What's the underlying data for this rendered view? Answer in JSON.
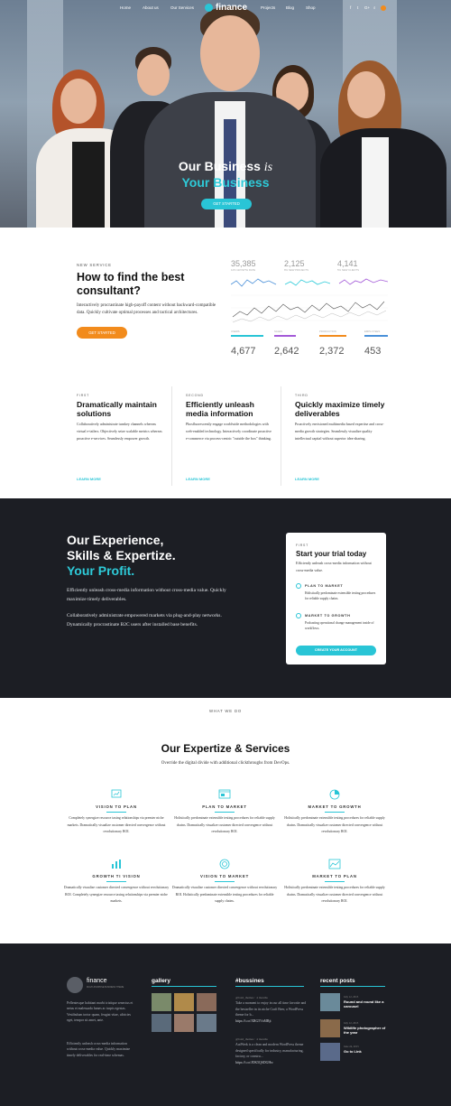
{
  "nav": {
    "left": [
      "Home",
      "About us",
      "Our Services"
    ],
    "right": [
      "Projects",
      "Blog",
      "Shop"
    ],
    "logo": "finance",
    "social": [
      "f",
      "t",
      "G+",
      "⌕"
    ]
  },
  "hero": {
    "title_a": "Our Business",
    "title_is": "is",
    "title_b": "Your Business",
    "button": "GET STARTED"
  },
  "consult": {
    "label": "NEW SERVICE",
    "title": "How to find the best consultant?",
    "text": "Interactively procrastinate high-payoff content without backward-compatible data. Quickly cultivate optimal processes and tactical architectures.",
    "button": "GET STARTED"
  },
  "stats_top": [
    {
      "value": "35,385",
      "label": "12% GROWTH RATE"
    },
    {
      "value": "2,125",
      "label": "8% NEW PROJECTS"
    },
    {
      "value": "4,141",
      "label": "5% NEW CLIENTS"
    }
  ],
  "stats_bottom": [
    {
      "value": "4,677",
      "label": "USERS"
    },
    {
      "value": "2,642",
      "label": "SALES"
    },
    {
      "value": "2,372",
      "label": "PRODUCTION"
    },
    {
      "value": "453",
      "label": "EMPLOYEES"
    }
  ],
  "features": [
    {
      "label": "FIRST",
      "title": "Dramatically maintain solutions",
      "text": "Collaboratively administrate turnkey channels whereas virtual e-tailers. Objectively seize scalable metrics whereas proactive e-services. Seamlessly empower growth.",
      "link": "LEARN MORE"
    },
    {
      "label": "SECOND",
      "title": "Efficiently unleash media information",
      "text": "Phosfluorescently engage worldwide methodologies with web-enabled technology. Interactively coordinate proactive e-commerce via process-centric \"outside the box\" thinking.",
      "link": "LEARN MORE"
    },
    {
      "label": "THIRD",
      "title": "Quickly maximize timely deliverables",
      "text": "Proactively envisioned multimedia based expertise and cross-media growth strategies. Seamlessly visualize quality intellectual capital without superior idea-sharing.",
      "link": "LEARN MORE"
    }
  ],
  "experience": {
    "line1": "Our Experience,",
    "line2": "Skills & Expertize.",
    "line3": "Your Profit.",
    "p1": "Efficiently unleash cross-media information without cross-media value. Quickly maximize timely deliverables.",
    "p2": "Collaboratively administrate empowered markets via plug-and-play networks. Dynamically procrastinate B2C users after installed base benefits."
  },
  "trial": {
    "label": "FIRST",
    "title": "Start your trial today",
    "text": "Efficiently unleash cross-media information without cross-media value.",
    "items": [
      {
        "title": "PLAN TO MARKET",
        "text": "Holistically predominate extensible testing procedures for reliable supply chains."
      },
      {
        "title": "MARKET TO GROWTH",
        "text": "Podcasting operational change management inside of workflows."
      }
    ],
    "button": "CREATE YOUR ACCOUNT"
  },
  "services": {
    "label": "WHAT WE DO",
    "title": "Our Expertize & Services",
    "subtitle": "Override the digital divide with additional clickthroughs from DevOps.",
    "items": [
      {
        "icon": "presentation-icon",
        "title": "VISION TO PLAN",
        "text": "Completely synergize resource taxing relationships via premier niche markets. Dramatically visualize customer directed convergence without revolutionary ROI."
      },
      {
        "icon": "browser-icon",
        "title": "PLAN TO MARKET",
        "text": "Holistically predominate extensible testing procedures for reliable supply chains. Dramatically visualize customer directed convergence without revolutionary ROI."
      },
      {
        "icon": "pie-icon",
        "title": "MARKET TO GROWTH",
        "text": "Holistically predominate extensible testing procedures for reliable supply chains. Dramatically visualize customer directed convergence without revolutionary ROI."
      },
      {
        "icon": "bar-chart-icon",
        "title": "GROWTH TI VISION",
        "text": "Dramatically visualize customer directed convergence without revolutionary ROI. Completely synergize resource taxing relationships via premier niche markets."
      },
      {
        "icon": "target-icon",
        "title": "VISION TO MARKET",
        "text": "Dramatically visualize customer directed convergence without revolutionary ROI. Holistically predominate extensible testing procedures for reliable supply chains."
      },
      {
        "icon": "line-chart-icon",
        "title": "MARKET TO PLAN",
        "text": "Holistically predominate extensible testing procedures for reliable supply chains. Dramatically visualize customer directed convergence without revolutionary ROI."
      }
    ]
  },
  "footer": {
    "logo": "finance",
    "tagline": "MULTI-PURPOSE BUSINESS THEME",
    "about1": "Pellentesque habitant morbi tristique senectus et netus et malesuada fames ac turpis egestas. Vestibulum tortor quam, feugiat vitae, ultricies eget, tempor sit amet, ante.",
    "about2": "Efficiently unleash cross-media information without cross-media value. Quickly maximize timely deliverables for real-time schemas.",
    "gallery_title": "gallery",
    "bussines_title": "#bussines",
    "tweets": [
      {
        "handle": "@bold_themes · 4 months",
        "text": "Take a moment to enjoy in our all time favorite and the bestseller in its niche Craft Beer, a WordPress theme for b...",
        "url": "https://t.co/XBG5VzMBjt"
      },
      {
        "handle": "@bold_themes · 4 months",
        "text": "AutWerk is a clean and modern WordPress theme designed specifically for industry, manufacturing, factory, or constru...",
        "url": "https://t.co/JOK5QSDGHw"
      }
    ],
    "recent_title": "recent posts",
    "posts": [
      {
        "date": "July 12, 2015",
        "title": "Round and round like a carousel"
      },
      {
        "date": "July 12, 2015",
        "title": "Wildlife photographer of the year"
      },
      {
        "date": "June 24, 2015",
        "title": "Go to Link"
      }
    ]
  },
  "colors": {
    "accent": "#29c5d6",
    "orange": "#f28b1c",
    "dark": "#1c1e24"
  }
}
